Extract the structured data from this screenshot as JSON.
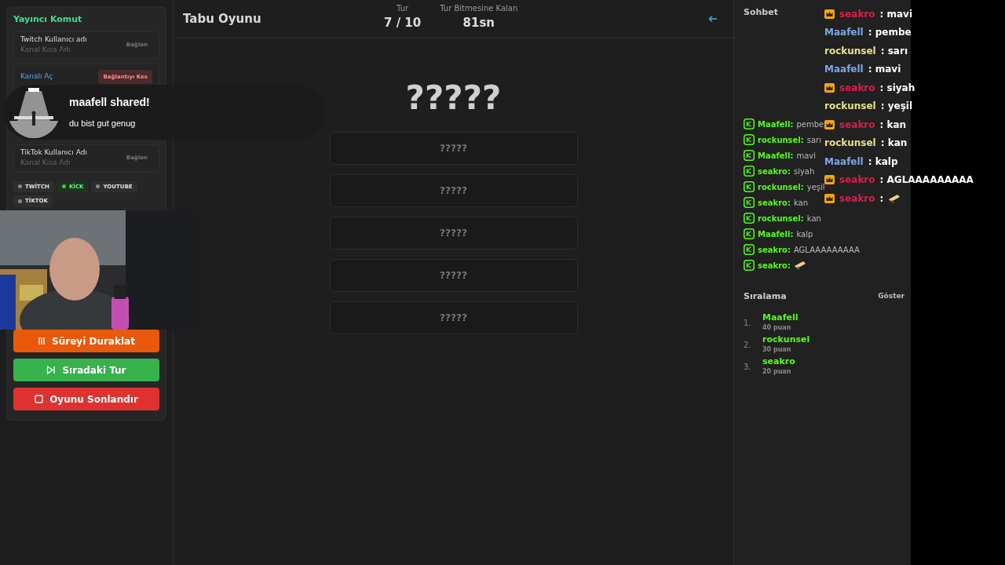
{
  "streamer_panel": {
    "title": "Yayıncı Komut",
    "connections": [
      {
        "kind": "input",
        "label": "Twitch Kullanıcı adı",
        "placeholder": "Kanal Kısa Adı",
        "button": "Bağlan",
        "connected": false
      },
      {
        "kind": "link",
        "label": "Kanalı Aç",
        "button": "Bağlantıyı Kes",
        "connected": true
      },
      {
        "kind": "input",
        "label": "TikTok Kullanıcı Adı",
        "placeholder": "Kanal Kısa Adı",
        "button": "Bağlan",
        "connected": false
      }
    ],
    "platforms": [
      {
        "label": "TWİTCH",
        "connected": false
      },
      {
        "label": "KİCK",
        "connected": true
      },
      {
        "label": "YOUTUBE",
        "connected": false
      },
      {
        "label": "TİKTOK",
        "connected": false
      }
    ],
    "actions": [
      {
        "kind": "pause",
        "label": "Süreyi Duraklat",
        "color": "#e8590c"
      },
      {
        "kind": "next",
        "label": "Sıradaki Tur",
        "color": "#37b24d"
      },
      {
        "kind": "stop",
        "label": "Oyunu Sonlandır",
        "color": "#e03131"
      }
    ]
  },
  "header": {
    "title": "Tabu Oyunu",
    "stats": [
      {
        "label": "Tur",
        "value": "7 / 10"
      },
      {
        "label": "Tur Bitmesine Kalan",
        "value": "81sn"
      }
    ]
  },
  "word": "?????",
  "forbidden_words": [
    "?????",
    "?????",
    "?????",
    "?????",
    "?????"
  ],
  "chat": {
    "title": "Sohbet",
    "messages": [
      {
        "user": "Maafell:",
        "kind": "text",
        "text": "pembe"
      },
      {
        "user": "rockunsel:",
        "kind": "text",
        "text": "sarı"
      },
      {
        "user": "Maafell:",
        "kind": "text",
        "text": "mavi"
      },
      {
        "user": "seakro:",
        "kind": "text",
        "text": "siyah"
      },
      {
        "user": "rockunsel:",
        "kind": "text",
        "text": "yeşil"
      },
      {
        "user": "seakro:",
        "kind": "text",
        "text": "kan"
      },
      {
        "user": "rockunsel:",
        "kind": "text",
        "text": "kan"
      },
      {
        "user": "Maafell:",
        "kind": "text",
        "text": "kalp"
      },
      {
        "user": "seakro:",
        "kind": "text",
        "text": "AGLAAAAAAAAA"
      },
      {
        "user": "seakro:",
        "kind": "emote"
      }
    ]
  },
  "ranking": {
    "title": "Sıralama",
    "toggle": "Göster",
    "entries": [
      {
        "rank": "1.",
        "name": "Maafell",
        "points": "40 puan"
      },
      {
        "rank": "2.",
        "name": "rockunsel",
        "points": "30 puan"
      },
      {
        "rank": "3.",
        "name": "seakro",
        "points": "20 puan"
      }
    ]
  },
  "chat_overlay": [
    {
      "user": "seakro",
      "color": "#d6204a",
      "badge": true,
      "kind": "text",
      "text": ": mavi"
    },
    {
      "user": "Maafell",
      "color": "#7aa7e6",
      "badge": false,
      "kind": "text",
      "text": ": pembe"
    },
    {
      "user": "rockunsel",
      "color": "#e6e08a",
      "badge": false,
      "kind": "text",
      "text": ": sarı"
    },
    {
      "user": "Maafell",
      "color": "#7aa7e6",
      "badge": false,
      "kind": "text",
      "text": ": mavi"
    },
    {
      "user": "seakro",
      "color": "#d6204a",
      "badge": true,
      "kind": "text",
      "text": ": siyah"
    },
    {
      "user": "rockunsel",
      "color": "#e6e08a",
      "badge": false,
      "kind": "text",
      "text": ": yeşil"
    },
    {
      "user": "seakro",
      "color": "#d6204a",
      "badge": true,
      "kind": "text",
      "text": ": kan"
    },
    {
      "user": "rockunsel",
      "color": "#e6e08a",
      "badge": false,
      "kind": "text",
      "text": ": kan"
    },
    {
      "user": "Maafell",
      "color": "#7aa7e6",
      "badge": false,
      "kind": "text",
      "text": ": kalp"
    },
    {
      "user": "seakro",
      "color": "#d6204a",
      "badge": true,
      "kind": "text",
      "text": ": AGLAAAAAAAAA"
    },
    {
      "user": "seakro",
      "color": "#d6204a",
      "badge": true,
      "kind": "emote",
      "text": ":"
    }
  ],
  "notification": {
    "title": "maafell shared!",
    "text": "du bist gut genug"
  }
}
